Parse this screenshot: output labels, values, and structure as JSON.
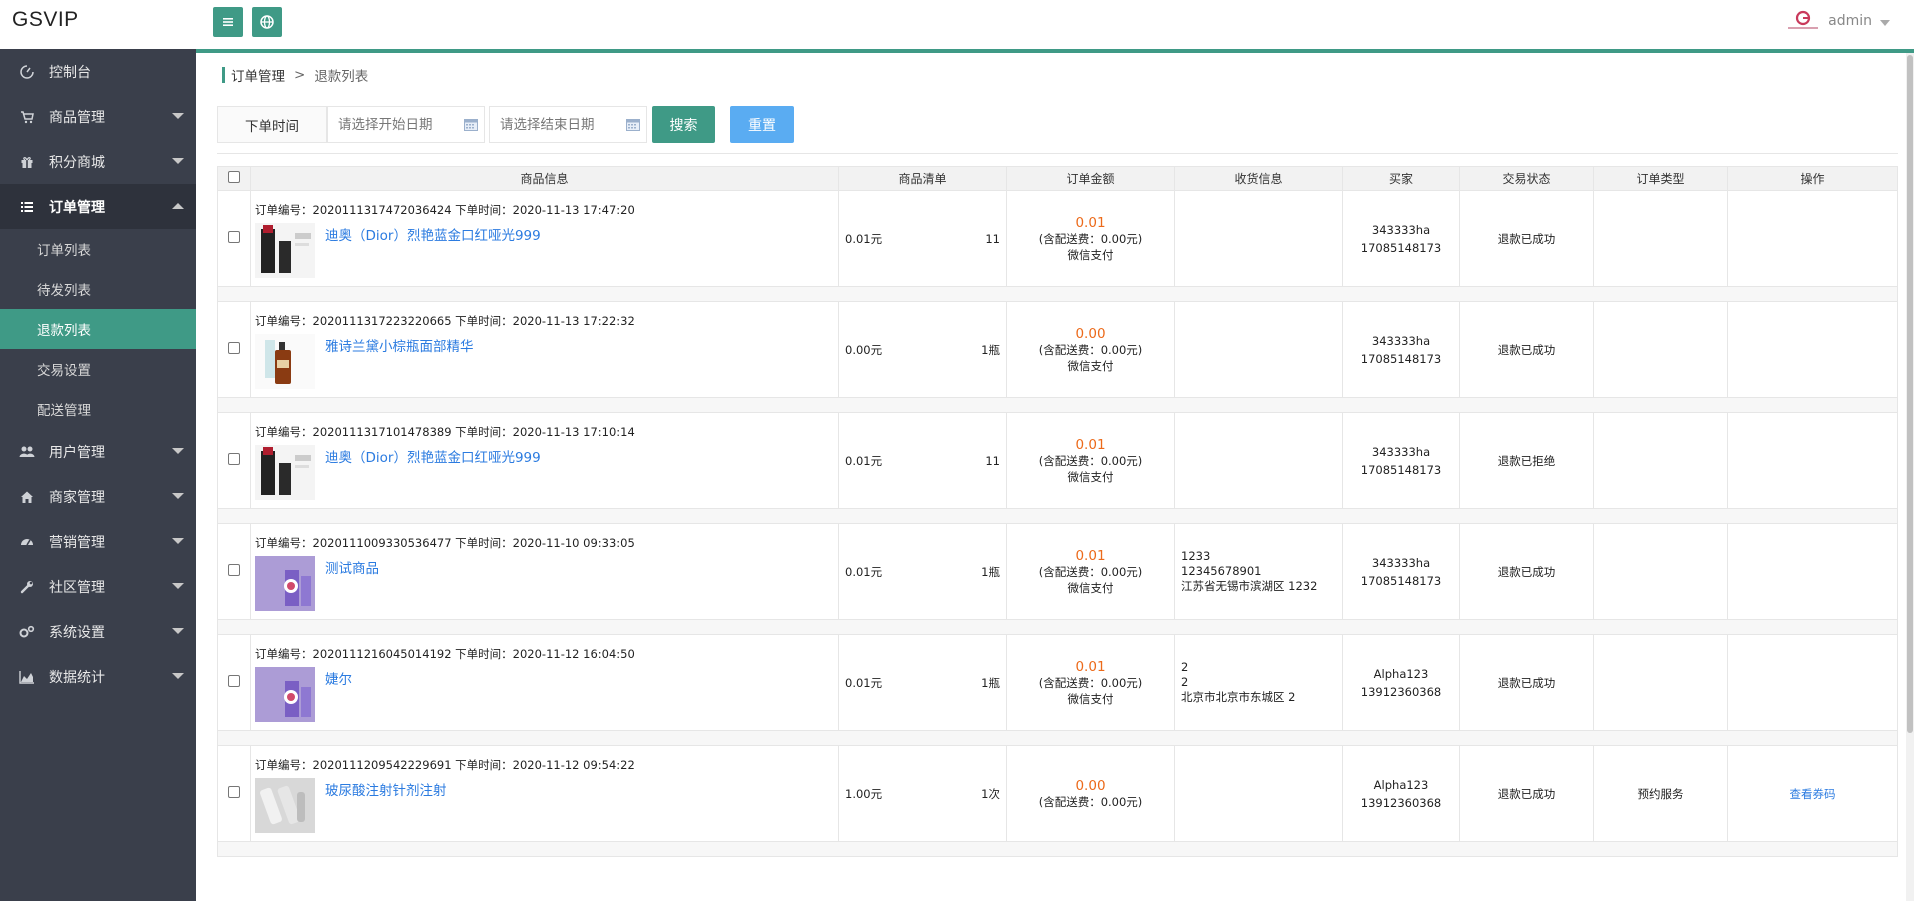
{
  "app": {
    "title": "GSVIP",
    "user": "admin"
  },
  "sidebar": {
    "items": [
      {
        "label": "控制台",
        "icon": "dashboard-icon",
        "has_arrow": false
      },
      {
        "label": "商品管理",
        "icon": "cart-icon",
        "has_arrow": true
      },
      {
        "label": "积分商城",
        "icon": "gift-icon",
        "has_arrow": true
      },
      {
        "label": "订单管理",
        "icon": "list-icon",
        "has_arrow": true,
        "open": true,
        "children": [
          {
            "label": "订单列表"
          },
          {
            "label": "待发列表"
          },
          {
            "label": "退款列表",
            "active": true
          },
          {
            "label": "交易设置"
          },
          {
            "label": "配送管理"
          }
        ]
      },
      {
        "label": "用户管理",
        "icon": "users-icon",
        "has_arrow": true
      },
      {
        "label": "商家管理",
        "icon": "home-icon",
        "has_arrow": true
      },
      {
        "label": "营销管理",
        "icon": "dashboard-gauge-icon",
        "has_arrow": true
      },
      {
        "label": "社区管理",
        "icon": "wrench-icon",
        "has_arrow": true
      },
      {
        "label": "系统设置",
        "icon": "gears-icon",
        "has_arrow": true
      },
      {
        "label": "数据统计",
        "icon": "area-chart-icon",
        "has_arrow": true
      }
    ]
  },
  "breadcrumb": {
    "parent": "订单管理",
    "separator": ">",
    "current": "退款列表"
  },
  "filter": {
    "label": "下单时间",
    "start_placeholder": "请选择开始日期",
    "end_placeholder": "请选择结束日期",
    "search_label": "搜索",
    "reset_label": "重置"
  },
  "table": {
    "headers": [
      "商品信息",
      "商品清单",
      "订单金额",
      "收货信息",
      "买家",
      "交易状态",
      "订单类型",
      "操作"
    ],
    "orders": [
      {
        "meta": "订单编号：2020111317472036424 下单时间：2020-11-13 17:47:20",
        "product": "迪奥（Dior）烈艳蓝金口红哑光999",
        "thumb": "lipstick",
        "unit_price": "0.01元",
        "qty": "11",
        "amount": "0.01",
        "shipping_fee": "(含配送费：0.00元)",
        "pay": "微信支付",
        "address": [],
        "buyer_name": "343333ha",
        "buyer_phone": "17085148173",
        "status": "退款已成功",
        "type": "",
        "action": ""
      },
      {
        "meta": "订单编号：2020111317223220665 下单时间：2020-11-13 17:22:32",
        "product": "雅诗兰黛小棕瓶面部精华",
        "thumb": "serum",
        "unit_price": "0.00元",
        "qty": "1瓶",
        "amount": "0.00",
        "shipping_fee": "(含配送费：0.00元)",
        "pay": "微信支付",
        "address": [],
        "buyer_name": "343333ha",
        "buyer_phone": "17085148173",
        "status": "退款已成功",
        "type": "",
        "action": ""
      },
      {
        "meta": "订单编号：2020111317101478389 下单时间：2020-11-13 17:10:14",
        "product": "迪奥（Dior）烈艳蓝金口红哑光999",
        "thumb": "lipstick",
        "unit_price": "0.01元",
        "qty": "11",
        "amount": "0.01",
        "shipping_fee": "(含配送费：0.00元)",
        "pay": "微信支付",
        "address": [],
        "buyer_name": "343333ha",
        "buyer_phone": "17085148173",
        "status": "退款已拒绝",
        "type": "",
        "action": ""
      },
      {
        "meta": "订单编号：2020111009330536477 下单时间：2020-11-10 09:33:05",
        "product": "测试商品",
        "thumb": "purple",
        "unit_price": "0.01元",
        "qty": "1瓶",
        "amount": "0.01",
        "shipping_fee": "(含配送费：0.00元)",
        "pay": "微信支付",
        "address": [
          "1233",
          "12345678901",
          "江苏省无锡市滨湖区 1232"
        ],
        "buyer_name": "343333ha",
        "buyer_phone": "17085148173",
        "status": "退款已成功",
        "type": "",
        "action": ""
      },
      {
        "meta": "订单编号：2020111216045014192 下单时间：2020-11-12 16:04:50",
        "product": "婕尔",
        "thumb": "purple",
        "unit_price": "0.01元",
        "qty": "1瓶",
        "amount": "0.01",
        "shipping_fee": "(含配送费：0.00元)",
        "pay": "微信支付",
        "address": [
          "2",
          "2",
          "北京市北京市东城区 2"
        ],
        "buyer_name": "Alpha123",
        "buyer_phone": "13912360368",
        "status": "退款已成功",
        "type": "",
        "action": ""
      },
      {
        "meta": "订单编号：2020111209542229691 下单时间：2020-11-12 09:54:22",
        "product": "玻尿酸注射针剂注射",
        "thumb": "gray",
        "unit_price": "1.00元",
        "qty": "1次",
        "amount": "0.00",
        "shipping_fee": "(含配送费：0.00元)",
        "pay": "",
        "address": [],
        "buyer_name": "Alpha123",
        "buyer_phone": "13912360368",
        "status": "退款已成功",
        "type": "预约服务",
        "action": "查看券码"
      }
    ]
  },
  "colors": {
    "accent": "#3f9a86",
    "sidebar_bg": "#3a3f4b",
    "reset_btn": "#5aacf2",
    "price": "#ec6a1a",
    "link": "#2b7be0"
  }
}
